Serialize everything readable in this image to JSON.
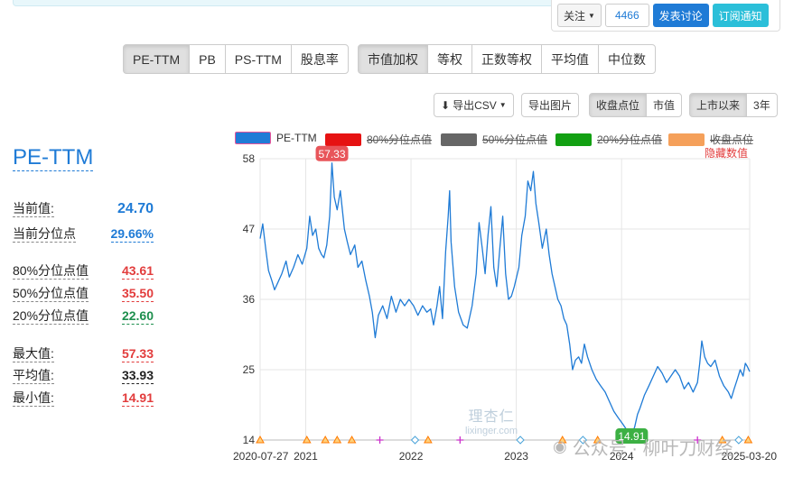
{
  "social": {
    "follow_label": "关注",
    "follow_count": "4466",
    "discuss_label": "发表讨论",
    "subscribe_label": "订阅通知"
  },
  "metric_tabs": [
    "PE-TTM",
    "PB",
    "PS-TTM",
    "股息率"
  ],
  "metric_active": 0,
  "weight_tabs": [
    "市值加权",
    "等权",
    "正数等权",
    "平均值",
    "中位数"
  ],
  "weight_active": 0,
  "toolbar": {
    "csv_label": "导出CSV",
    "image_label": "导出图片"
  },
  "price_tabs": [
    "收盘点位",
    "市值"
  ],
  "price_active": 0,
  "range_tabs": [
    "上市以来",
    "3年"
  ],
  "range_active": 0,
  "side": {
    "title": "PE-TTM",
    "stats": [
      {
        "label": "当前值:",
        "value": "24.70",
        "color": "#1f7bd6"
      },
      {
        "label": "当前分位点",
        "value": "29.66%",
        "color": "#1f7bd6"
      },
      {
        "label": "80%分位点值",
        "value": "43.61",
        "color": "#e23c3c"
      },
      {
        "label": "50%分位点值",
        "value": "35.50",
        "color": "#e23c3c"
      },
      {
        "label": "20%分位点值",
        "value": "22.60",
        "color": "#1e8f4e"
      },
      {
        "label": "最大值:",
        "value": "57.33",
        "color": "#e23c3c"
      },
      {
        "label": "平均值:",
        "value": "33.93",
        "color": "#222222"
      },
      {
        "label": "最小值:",
        "value": "14.91",
        "color": "#e23c3c"
      }
    ]
  },
  "legend": {
    "items": [
      {
        "label": "PE-TTM",
        "color": "#1f7bd6",
        "active": true
      },
      {
        "label": "80%分位点值",
        "color": "#e61212",
        "active": false
      },
      {
        "label": "50%分位点值",
        "color": "#666666",
        "active": false
      },
      {
        "label": "20%分位点值",
        "color": "#12a012",
        "active": false
      },
      {
        "label": "收盘点位",
        "color": "#f5a05a",
        "active": false
      }
    ],
    "hide_values_label": "隐藏数值"
  },
  "watermark": {
    "site_name": "理杏仁",
    "site_url": "lixinger.com",
    "wechat": "公众号 · 柳叶刀财经"
  },
  "chart_data": {
    "type": "line",
    "ylim": [
      14,
      58
    ],
    "y_ticks": [
      14,
      25,
      36,
      47,
      58
    ],
    "x_tick_labels": [
      "2020-07-27",
      "2021",
      "2022",
      "2023",
      "2024",
      "2025-03-20"
    ],
    "x_tick_dates": [
      "2020-07-27",
      "2021-01-01",
      "2022-01-01",
      "2023-01-01",
      "2024-01-01",
      "2025-03-20"
    ],
    "grid": true,
    "series": [
      {
        "name": "PE-TTM",
        "color": "#1f7bd6",
        "points": [
          [
            "2020-07-27",
            45.5
          ],
          [
            "2020-08-05",
            47.8
          ],
          [
            "2020-08-15",
            44.0
          ],
          [
            "2020-08-25",
            40.5
          ],
          [
            "2020-09-05",
            39.0
          ],
          [
            "2020-09-15",
            37.5
          ],
          [
            "2020-09-25",
            38.5
          ],
          [
            "2020-10-10",
            40.0
          ],
          [
            "2020-10-25",
            42.0
          ],
          [
            "2020-11-05",
            39.5
          ],
          [
            "2020-11-20",
            41.0
          ],
          [
            "2020-12-05",
            43.0
          ],
          [
            "2020-12-20",
            41.5
          ],
          [
            "2021-01-05",
            44.0
          ],
          [
            "2021-01-15",
            49.0
          ],
          [
            "2021-01-25",
            46.0
          ],
          [
            "2021-02-05",
            47.0
          ],
          [
            "2021-02-15",
            44.0
          ],
          [
            "2021-02-25",
            43.0
          ],
          [
            "2021-03-05",
            42.5
          ],
          [
            "2021-03-15",
            44.5
          ],
          [
            "2021-03-25",
            49.0
          ],
          [
            "2021-04-02",
            57.33
          ],
          [
            "2021-04-10",
            52.0
          ],
          [
            "2021-04-20",
            50.0
          ],
          [
            "2021-05-01",
            53.0
          ],
          [
            "2021-05-15",
            47.0
          ],
          [
            "2021-05-25",
            45.0
          ],
          [
            "2021-06-05",
            43.0
          ],
          [
            "2021-06-20",
            44.5
          ],
          [
            "2021-07-01",
            41.0
          ],
          [
            "2021-07-15",
            42.0
          ],
          [
            "2021-07-28",
            39.0
          ],
          [
            "2021-08-10",
            36.5
          ],
          [
            "2021-08-20",
            34.0
          ],
          [
            "2021-08-30",
            30.0
          ],
          [
            "2021-09-10",
            33.5
          ],
          [
            "2021-09-25",
            35.0
          ],
          [
            "2021-10-10",
            33.0
          ],
          [
            "2021-10-25",
            36.5
          ],
          [
            "2021-11-10",
            34.0
          ],
          [
            "2021-11-25",
            36.0
          ],
          [
            "2021-12-10",
            35.0
          ],
          [
            "2021-12-25",
            36.0
          ],
          [
            "2022-01-10",
            35.0
          ],
          [
            "2022-01-25",
            33.5
          ],
          [
            "2022-02-10",
            35.0
          ],
          [
            "2022-02-25",
            34.0
          ],
          [
            "2022-03-10",
            34.5
          ],
          [
            "2022-03-20",
            32.0
          ],
          [
            "2022-04-01",
            35.0
          ],
          [
            "2022-04-10",
            38.0
          ],
          [
            "2022-04-20",
            33.0
          ],
          [
            "2022-05-01",
            43.5
          ],
          [
            "2022-05-10",
            49.0
          ],
          [
            "2022-05-15",
            53.0
          ],
          [
            "2022-05-20",
            45.0
          ],
          [
            "2022-06-01",
            38.0
          ],
          [
            "2022-06-15",
            34.0
          ],
          [
            "2022-07-01",
            32.0
          ],
          [
            "2022-07-15",
            31.5
          ],
          [
            "2022-08-01",
            35.0
          ],
          [
            "2022-08-15",
            40.0
          ],
          [
            "2022-08-25",
            48.0
          ],
          [
            "2022-09-05",
            44.0
          ],
          [
            "2022-09-15",
            40.0
          ],
          [
            "2022-09-25",
            46.0
          ],
          [
            "2022-10-05",
            50.5
          ],
          [
            "2022-10-15",
            41.0
          ],
          [
            "2022-10-25",
            38.0
          ],
          [
            "2022-11-05",
            44.0
          ],
          [
            "2022-11-15",
            49.0
          ],
          [
            "2022-11-25",
            40.0
          ],
          [
            "2022-12-05",
            36.0
          ],
          [
            "2022-12-15",
            36.5
          ],
          [
            "2022-12-25",
            38.0
          ],
          [
            "2023-01-10",
            41.0
          ],
          [
            "2023-01-20",
            46.0
          ],
          [
            "2023-02-01",
            49.0
          ],
          [
            "2023-02-10",
            54.5
          ],
          [
            "2023-02-20",
            53.0
          ],
          [
            "2023-03-01",
            56.0
          ],
          [
            "2023-03-10",
            51.0
          ],
          [
            "2023-03-20",
            48.0
          ],
          [
            "2023-04-01",
            44.0
          ],
          [
            "2023-04-15",
            47.0
          ],
          [
            "2023-04-25",
            43.0
          ],
          [
            "2023-05-05",
            40.0
          ],
          [
            "2023-05-15",
            38.0
          ],
          [
            "2023-05-25",
            36.0
          ],
          [
            "2023-06-05",
            35.0
          ],
          [
            "2023-06-15",
            33.0
          ],
          [
            "2023-06-25",
            32.0
          ],
          [
            "2023-07-05",
            29.0
          ],
          [
            "2023-07-15",
            25.0
          ],
          [
            "2023-07-25",
            26.5
          ],
          [
            "2023-08-05",
            27.0
          ],
          [
            "2023-08-15",
            26.0
          ],
          [
            "2023-08-25",
            29.0
          ],
          [
            "2023-09-05",
            27.0
          ],
          [
            "2023-09-20",
            25.0
          ],
          [
            "2023-10-05",
            23.5
          ],
          [
            "2023-10-20",
            22.5
          ],
          [
            "2023-11-05",
            21.5
          ],
          [
            "2023-11-20",
            20.0
          ],
          [
            "2023-12-05",
            18.5
          ],
          [
            "2023-12-20",
            17.5
          ],
          [
            "2024-01-05",
            16.5
          ],
          [
            "2024-01-20",
            15.5
          ],
          [
            "2024-02-05",
            14.91
          ],
          [
            "2024-02-15",
            16.0
          ],
          [
            "2024-02-25",
            18.0
          ],
          [
            "2024-03-05",
            19.0
          ],
          [
            "2024-03-20",
            21.0
          ],
          [
            "2024-04-05",
            22.5
          ],
          [
            "2024-04-20",
            24.0
          ],
          [
            "2024-05-05",
            25.5
          ],
          [
            "2024-05-20",
            24.5
          ],
          [
            "2024-06-05",
            23.0
          ],
          [
            "2024-06-20",
            24.0
          ],
          [
            "2024-07-05",
            25.0
          ],
          [
            "2024-07-20",
            24.0
          ],
          [
            "2024-08-05",
            22.0
          ],
          [
            "2024-08-20",
            23.0
          ],
          [
            "2024-09-05",
            21.5
          ],
          [
            "2024-09-20",
            23.0
          ],
          [
            "2024-09-28",
            26.0
          ],
          [
            "2024-10-05",
            29.5
          ],
          [
            "2024-10-15",
            27.0
          ],
          [
            "2024-10-25",
            26.0
          ],
          [
            "2024-11-05",
            25.5
          ],
          [
            "2024-11-20",
            26.5
          ],
          [
            "2024-12-05",
            24.0
          ],
          [
            "2024-12-20",
            22.5
          ],
          [
            "2025-01-05",
            21.5
          ],
          [
            "2025-01-15",
            20.5
          ],
          [
            "2025-01-25",
            22.0
          ],
          [
            "2025-02-05",
            23.5
          ],
          [
            "2025-02-15",
            25.0
          ],
          [
            "2025-02-25",
            24.0
          ],
          [
            "2025-03-05",
            26.0
          ],
          [
            "2025-03-12",
            25.5
          ],
          [
            "2025-03-20",
            24.7
          ]
        ]
      }
    ],
    "annotations": [
      {
        "label": "57.33",
        "x": "2021-04-02",
        "y": 57.33,
        "color": "#e8555a"
      },
      {
        "label": "14.91",
        "x": "2024-02-05",
        "y": 14.91,
        "color": "#3cb043"
      }
    ],
    "event_markers": [
      {
        "x": "2020-07-27",
        "shape": "triangle",
        "color": "#ff7a00"
      },
      {
        "x": "2021-01-05",
        "shape": "triangle",
        "color": "#ff7a00"
      },
      {
        "x": "2021-03-10",
        "shape": "triangle",
        "color": "#ff7a00"
      },
      {
        "x": "2021-04-20",
        "shape": "triangle",
        "color": "#ff7a00"
      },
      {
        "x": "2021-06-10",
        "shape": "triangle",
        "color": "#ff7a00"
      },
      {
        "x": "2021-09-15",
        "shape": "plus",
        "color": "#cc33cc"
      },
      {
        "x": "2022-01-15",
        "shape": "diamond",
        "color": "#4aa3d9"
      },
      {
        "x": "2022-03-01",
        "shape": "triangle",
        "color": "#ff7a00"
      },
      {
        "x": "2022-06-20",
        "shape": "plus",
        "color": "#cc33cc"
      },
      {
        "x": "2023-01-15",
        "shape": "diamond",
        "color": "#4aa3d9"
      },
      {
        "x": "2023-06-10",
        "shape": "triangle",
        "color": "#ff7a00"
      },
      {
        "x": "2023-08-20",
        "shape": "diamond",
        "color": "#4aa3d9"
      },
      {
        "x": "2023-10-10",
        "shape": "triangle",
        "color": "#ff7a00"
      },
      {
        "x": "2024-09-20",
        "shape": "plus",
        "color": "#cc33cc"
      },
      {
        "x": "2024-12-15",
        "shape": "triangle",
        "color": "#ff7a00"
      },
      {
        "x": "2025-02-10",
        "shape": "diamond",
        "color": "#4aa3d9"
      },
      {
        "x": "2025-03-15",
        "shape": "triangle",
        "color": "#ff7a00"
      }
    ]
  }
}
